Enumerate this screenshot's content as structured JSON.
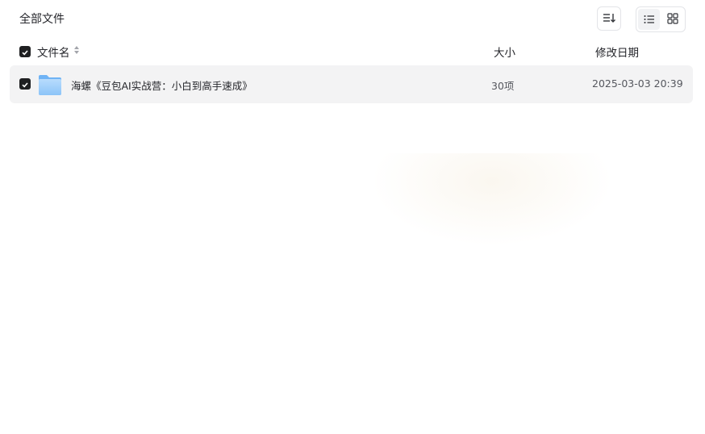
{
  "header": {
    "title": "全部文件",
    "sort_icon": "sort-order-icon",
    "view_modes": [
      {
        "name": "list",
        "icon": "list-view-icon",
        "active": true
      },
      {
        "name": "grid",
        "icon": "grid-view-icon",
        "active": false
      }
    ]
  },
  "columns": {
    "name": "文件名",
    "size": "大小",
    "date": "修改日期"
  },
  "files": [
    {
      "checked": true,
      "type": "folder",
      "name": "海螺《豆包AI实战营：小白到高手速成》",
      "size": "30项",
      "modified": "2025-03-03 20:39"
    }
  ],
  "colors": {
    "row_background": "#f3f3f4",
    "checkbox": "#1f2022",
    "folder_light": "#a9d4fb",
    "folder_dark": "#6fb3f5"
  }
}
